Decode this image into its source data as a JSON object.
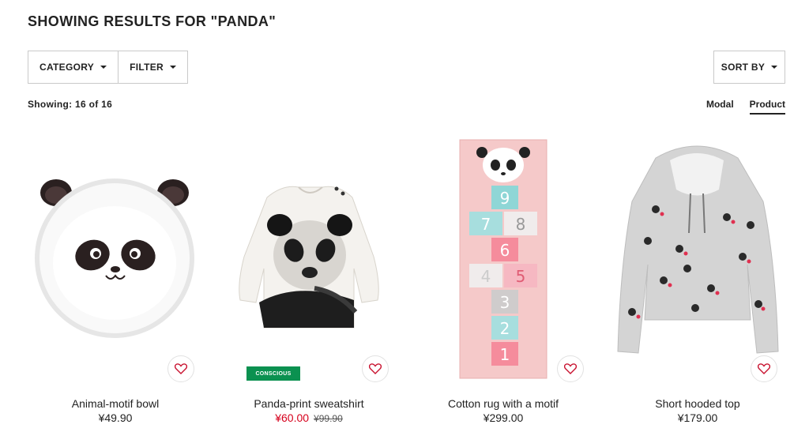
{
  "page": {
    "title": "SHOWING RESULTS FOR \"PANDA\""
  },
  "toolbar": {
    "category_label": "CATEGORY",
    "filter_label": "FILTER",
    "sort_label": "SORT BY",
    "showing_text": "Showing: 16 of 16",
    "view_options": [
      "Modal",
      "Product"
    ],
    "active_view": "Product"
  },
  "colors": {
    "sale": "#d6001c",
    "conscious": "#0b9150",
    "heart": "#c8102e"
  },
  "products": [
    {
      "name": "Animal-motif bowl",
      "price": "¥49.90",
      "image_icon": "panda-bowl-image"
    },
    {
      "name": "Panda-print sweatshirt",
      "sale_price": "¥60.00",
      "old_price": "¥99.90",
      "badge": "CONSCIOUS",
      "image_icon": "panda-sweatshirt-image"
    },
    {
      "name": "Cotton rug with a motif",
      "price": "¥299.00",
      "image_icon": "panda-hopscotch-rug-image"
    },
    {
      "name": "Short hooded top",
      "price": "¥179.00",
      "image_icon": "panda-hoodie-image"
    }
  ]
}
